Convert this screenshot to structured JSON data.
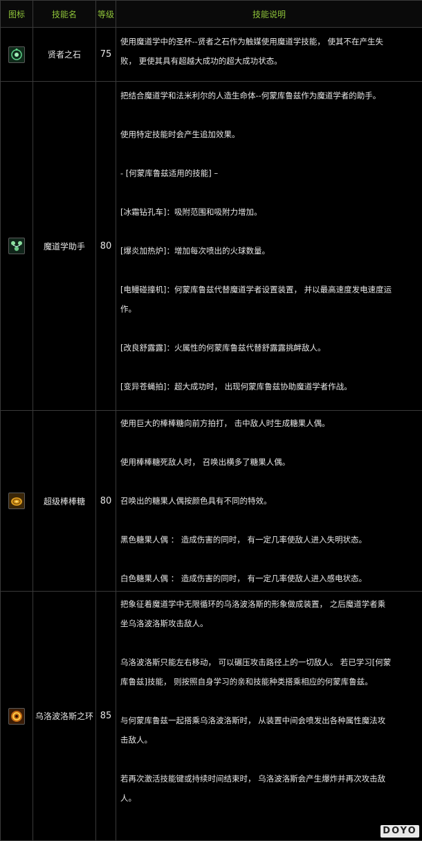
{
  "header": {
    "col_icon": "图标",
    "col_name": "技能名",
    "col_level": "等级",
    "col_desc": "技能说明"
  },
  "skills": [
    {
      "icon": "philosopher-stone-icon",
      "name": "贤者之石",
      "level": "75",
      "lines": [
        "使用魔道学中的圣杯--贤者之石作为触媒使用魔道学技能， 使其不在产生失",
        "败， 更使其具有超越大成功的超大成功状态。"
      ]
    },
    {
      "icon": "homunculus-assistant-icon",
      "name": "魔道学助手",
      "level": "80",
      "lines": [
        "把结合魔道学和法米利尔的人造生命体--何蒙库鲁兹作为魔道学者的助手。",
        "",
        "使用特定技能时会产生追加效果。",
        "",
        "- [何蒙库鲁兹适用的技能] –",
        "",
        "[冰霜钻孔车]：吸附范围和吸附力增加。",
        "",
        "[爆炎加热炉]：增加每次喷出的火球数量。",
        "",
        "[电鳗碰撞机]：何蒙库鲁兹代替魔道学者设置装置， 并以最高速度发电速度运",
        "作。",
        "",
        "[改良舒露露]：火属性的何蒙库鲁兹代替舒露露挑衅敌人。",
        "",
        "[变异苍蝇拍]：超大成功时， 出现何蒙库鲁兹协助魔道学者作战。"
      ]
    },
    {
      "icon": "super-lollipop-icon",
      "name": "超级棒棒糖",
      "level": "80",
      "lines": [
        "使用巨大的棒棒糖向前方拍打， 击中敌人时生成糖果人偶。",
        "",
        "使用棒棒糖死敌人时， 召唤出横多了糖果人偶。",
        "",
        "召唤出的糖果人偶按颜色具有不同的特效。",
        "",
        "黑色糖果人偶 ： 造成伤害的同时， 有一定几率使敌人进入失明状态。",
        "",
        "白色糖果人偶 ： 造成伤害的同时， 有一定几率使敌人进入感电状态。"
      ]
    },
    {
      "icon": "ouroboros-ring-icon",
      "name": "乌洛波洛斯之环",
      "level": "85",
      "lines": [
        "把象征着魔道学中无限循环的乌洛波洛斯的形象做成装置， 之后魔道学者乘",
        "坐乌洛波洛斯攻击敌人。",
        "",
        "乌洛波洛斯只能左右移动， 可以碾压攻击路径上的一切敌人。 若已学习[何蒙",
        "库鲁兹]技能， 则按照自身学习的亲和技能种类搭乘相应的何蒙库鲁兹。",
        "",
        "与何蒙库鲁兹一起搭乘乌洛波洛斯时， 从装置中间会喷发出各种属性魔法攻",
        "击敌人。",
        "",
        "若再次激活技能键或持续时间结束时， 乌洛波洛斯会产生爆炸并再次攻击敌",
        "人。"
      ]
    }
  ],
  "watermark": "DOYO"
}
